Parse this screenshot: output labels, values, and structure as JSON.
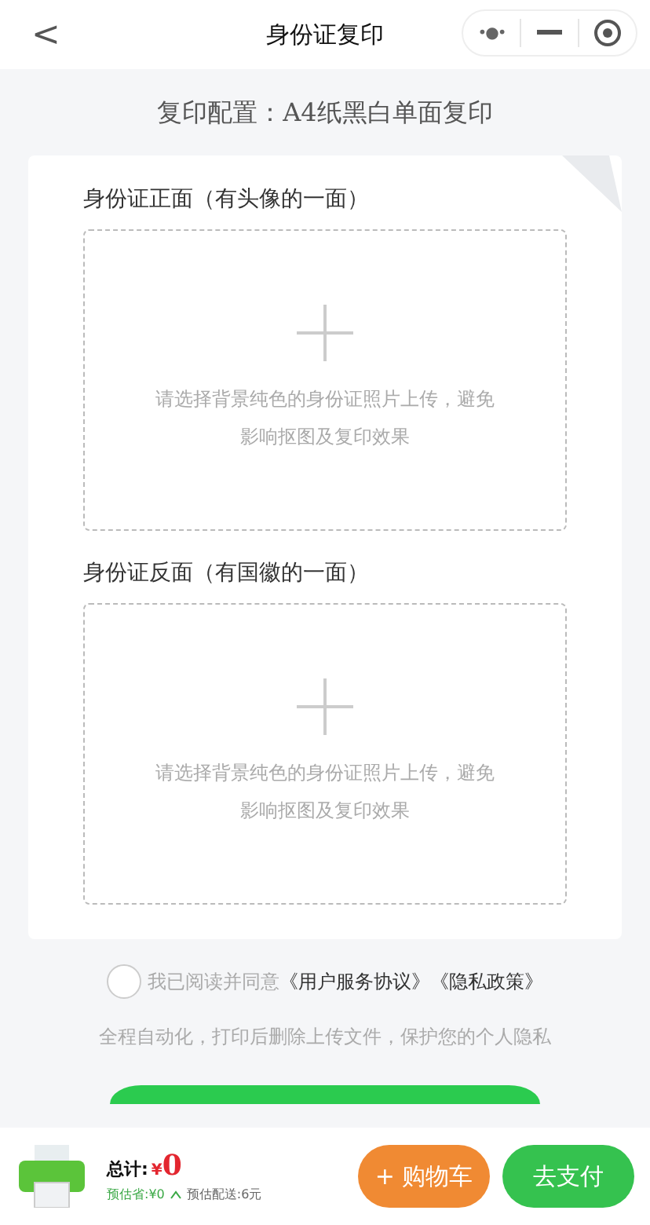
{
  "header": {
    "title": "身份证复印",
    "back_icon": "<",
    "more_icon": "•●•"
  },
  "config_text": "复印配置：A4纸黑白单面复印",
  "uploads": [
    {
      "title": "身份证正面（有头像的一面）",
      "hint": "请选择背景纯色的身份证照片上传，避免影响抠图及复印效果"
    },
    {
      "title": "身份证反面（有国徽的一面）",
      "hint": "请选择背景纯色的身份证照片上传，避免影响抠图及复印效果"
    }
  ],
  "agreement": {
    "checked": false,
    "text": "我已阅读并同意",
    "links": [
      "《用户服务协议》",
      "《隐私政策》"
    ]
  },
  "privacy_note": "全程自动化，打印后删除上传文件，保护您的个人隐私",
  "bottom_bar": {
    "total_label": "总计:",
    "currency": "¥",
    "total": "0",
    "saved": "预估省:¥0",
    "delivery": "预估配送:6元",
    "cart_button": "+ 购物车",
    "pay_button": "去支付"
  }
}
